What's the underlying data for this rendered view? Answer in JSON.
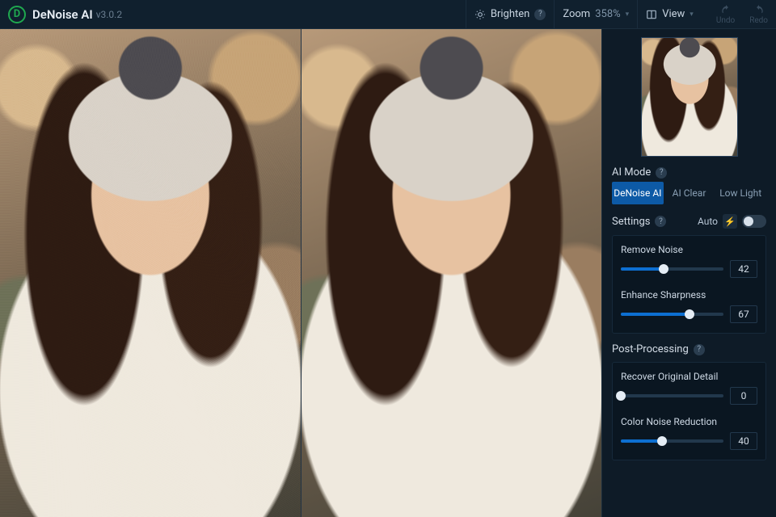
{
  "header": {
    "app_name": "DeNoise AI",
    "version": "v3.0.2",
    "brighten_label": "Brighten",
    "zoom_label": "Zoom",
    "zoom_value": "358%",
    "view_label": "View",
    "undo_label": "Undo",
    "redo_label": "Redo"
  },
  "ai_mode": {
    "title": "AI Mode",
    "tabs": [
      {
        "label": "DeNoise AI",
        "active": true
      },
      {
        "label": "AI Clear",
        "active": false
      },
      {
        "label": "Low Light",
        "active": false
      }
    ]
  },
  "settings": {
    "title": "Settings",
    "auto_label": "Auto",
    "auto_on": false,
    "sliders": [
      {
        "label": "Remove Noise",
        "value": 42,
        "min": 0,
        "max": 100
      },
      {
        "label": "Enhance Sharpness",
        "value": 67,
        "min": 0,
        "max": 100
      }
    ]
  },
  "post": {
    "title": "Post-Processing",
    "sliders": [
      {
        "label": "Recover Original Detail",
        "value": 0,
        "min": 0,
        "max": 100
      },
      {
        "label": "Color Noise Reduction",
        "value": 40,
        "min": 0,
        "max": 100
      }
    ]
  },
  "colors": {
    "accent": "#0d6fd1",
    "brand": "#1fa84f"
  }
}
